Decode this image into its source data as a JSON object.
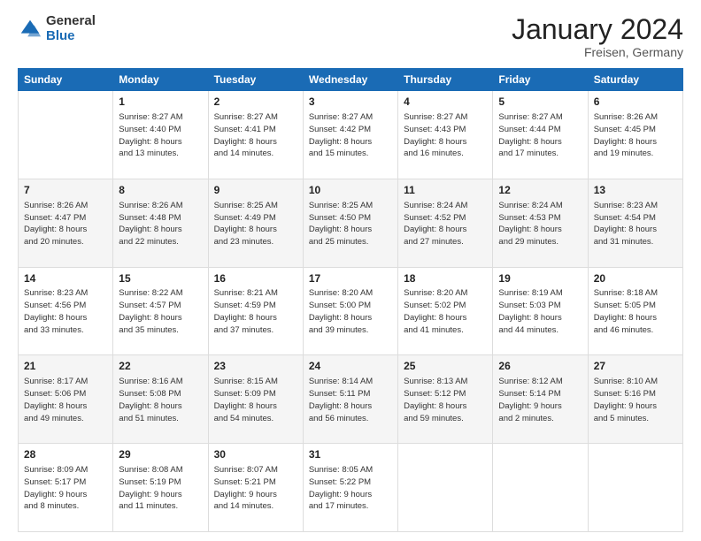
{
  "header": {
    "logo_line1": "General",
    "logo_line2": "Blue",
    "title": "January 2024",
    "subtitle": "Freisen, Germany"
  },
  "columns": [
    "Sunday",
    "Monday",
    "Tuesday",
    "Wednesday",
    "Thursday",
    "Friday",
    "Saturday"
  ],
  "weeks": [
    [
      {
        "num": "",
        "info": ""
      },
      {
        "num": "1",
        "info": "Sunrise: 8:27 AM\nSunset: 4:40 PM\nDaylight: 8 hours\nand 13 minutes."
      },
      {
        "num": "2",
        "info": "Sunrise: 8:27 AM\nSunset: 4:41 PM\nDaylight: 8 hours\nand 14 minutes."
      },
      {
        "num": "3",
        "info": "Sunrise: 8:27 AM\nSunset: 4:42 PM\nDaylight: 8 hours\nand 15 minutes."
      },
      {
        "num": "4",
        "info": "Sunrise: 8:27 AM\nSunset: 4:43 PM\nDaylight: 8 hours\nand 16 minutes."
      },
      {
        "num": "5",
        "info": "Sunrise: 8:27 AM\nSunset: 4:44 PM\nDaylight: 8 hours\nand 17 minutes."
      },
      {
        "num": "6",
        "info": "Sunrise: 8:26 AM\nSunset: 4:45 PM\nDaylight: 8 hours\nand 19 minutes."
      }
    ],
    [
      {
        "num": "7",
        "info": "Sunrise: 8:26 AM\nSunset: 4:47 PM\nDaylight: 8 hours\nand 20 minutes."
      },
      {
        "num": "8",
        "info": "Sunrise: 8:26 AM\nSunset: 4:48 PM\nDaylight: 8 hours\nand 22 minutes."
      },
      {
        "num": "9",
        "info": "Sunrise: 8:25 AM\nSunset: 4:49 PM\nDaylight: 8 hours\nand 23 minutes."
      },
      {
        "num": "10",
        "info": "Sunrise: 8:25 AM\nSunset: 4:50 PM\nDaylight: 8 hours\nand 25 minutes."
      },
      {
        "num": "11",
        "info": "Sunrise: 8:24 AM\nSunset: 4:52 PM\nDaylight: 8 hours\nand 27 minutes."
      },
      {
        "num": "12",
        "info": "Sunrise: 8:24 AM\nSunset: 4:53 PM\nDaylight: 8 hours\nand 29 minutes."
      },
      {
        "num": "13",
        "info": "Sunrise: 8:23 AM\nSunset: 4:54 PM\nDaylight: 8 hours\nand 31 minutes."
      }
    ],
    [
      {
        "num": "14",
        "info": "Sunrise: 8:23 AM\nSunset: 4:56 PM\nDaylight: 8 hours\nand 33 minutes."
      },
      {
        "num": "15",
        "info": "Sunrise: 8:22 AM\nSunset: 4:57 PM\nDaylight: 8 hours\nand 35 minutes."
      },
      {
        "num": "16",
        "info": "Sunrise: 8:21 AM\nSunset: 4:59 PM\nDaylight: 8 hours\nand 37 minutes."
      },
      {
        "num": "17",
        "info": "Sunrise: 8:20 AM\nSunset: 5:00 PM\nDaylight: 8 hours\nand 39 minutes."
      },
      {
        "num": "18",
        "info": "Sunrise: 8:20 AM\nSunset: 5:02 PM\nDaylight: 8 hours\nand 41 minutes."
      },
      {
        "num": "19",
        "info": "Sunrise: 8:19 AM\nSunset: 5:03 PM\nDaylight: 8 hours\nand 44 minutes."
      },
      {
        "num": "20",
        "info": "Sunrise: 8:18 AM\nSunset: 5:05 PM\nDaylight: 8 hours\nand 46 minutes."
      }
    ],
    [
      {
        "num": "21",
        "info": "Sunrise: 8:17 AM\nSunset: 5:06 PM\nDaylight: 8 hours\nand 49 minutes."
      },
      {
        "num": "22",
        "info": "Sunrise: 8:16 AM\nSunset: 5:08 PM\nDaylight: 8 hours\nand 51 minutes."
      },
      {
        "num": "23",
        "info": "Sunrise: 8:15 AM\nSunset: 5:09 PM\nDaylight: 8 hours\nand 54 minutes."
      },
      {
        "num": "24",
        "info": "Sunrise: 8:14 AM\nSunset: 5:11 PM\nDaylight: 8 hours\nand 56 minutes."
      },
      {
        "num": "25",
        "info": "Sunrise: 8:13 AM\nSunset: 5:12 PM\nDaylight: 8 hours\nand 59 minutes."
      },
      {
        "num": "26",
        "info": "Sunrise: 8:12 AM\nSunset: 5:14 PM\nDaylight: 9 hours\nand 2 minutes."
      },
      {
        "num": "27",
        "info": "Sunrise: 8:10 AM\nSunset: 5:16 PM\nDaylight: 9 hours\nand 5 minutes."
      }
    ],
    [
      {
        "num": "28",
        "info": "Sunrise: 8:09 AM\nSunset: 5:17 PM\nDaylight: 9 hours\nand 8 minutes."
      },
      {
        "num": "29",
        "info": "Sunrise: 8:08 AM\nSunset: 5:19 PM\nDaylight: 9 hours\nand 11 minutes."
      },
      {
        "num": "30",
        "info": "Sunrise: 8:07 AM\nSunset: 5:21 PM\nDaylight: 9 hours\nand 14 minutes."
      },
      {
        "num": "31",
        "info": "Sunrise: 8:05 AM\nSunset: 5:22 PM\nDaylight: 9 hours\nand 17 minutes."
      },
      {
        "num": "",
        "info": ""
      },
      {
        "num": "",
        "info": ""
      },
      {
        "num": "",
        "info": ""
      }
    ]
  ]
}
